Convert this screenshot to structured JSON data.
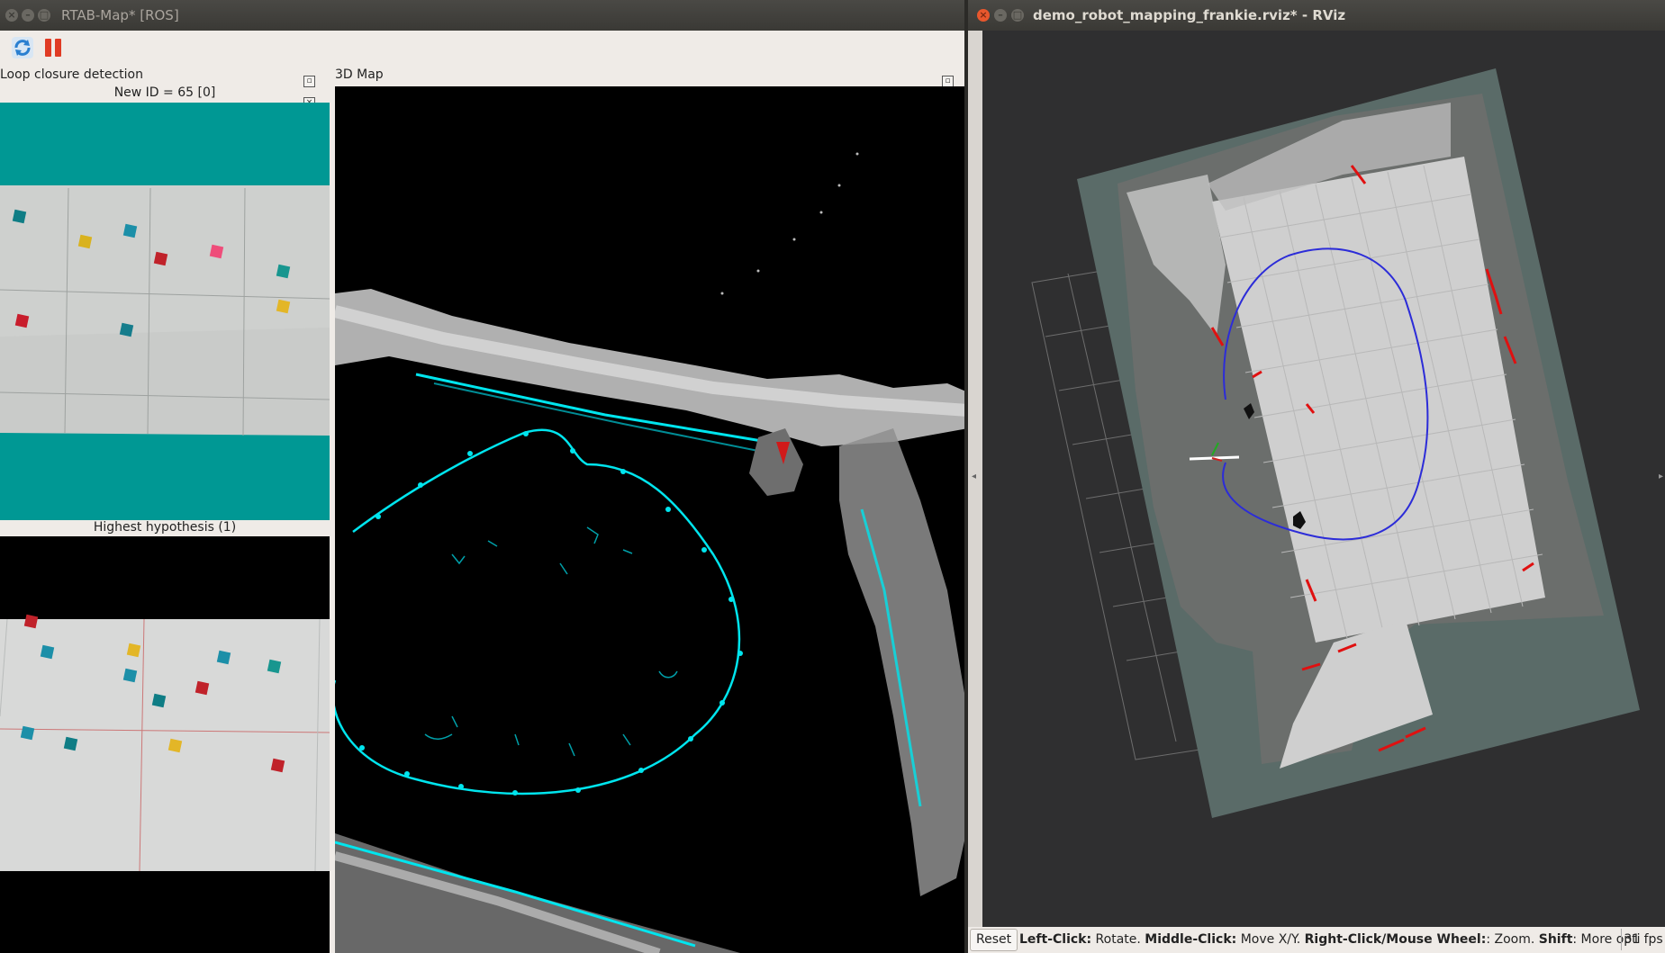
{
  "left_window": {
    "title": "RTAB-Map* [ROS]",
    "toolbar": {
      "refresh_icon": "refresh-icon",
      "pause_icon": "pause-icon"
    },
    "loop_panel": {
      "title": "Loop closure detection",
      "new_id_caption": "New ID = 65 [0]",
      "hypothesis_caption": "Highest hypothesis (1)"
    },
    "map_panel": {
      "title": "3D Map"
    },
    "colors": {
      "teal_band": "#009894",
      "trajectory": "#00e5ee",
      "panel_bg": "#efebe7"
    }
  },
  "right_window": {
    "title": "demo_robot_mapping_frankie.rviz* - RViz",
    "status": {
      "reset_label": "Reset",
      "hint_parts": [
        {
          "bold": "Left-Click:",
          "text": " Rotate. "
        },
        {
          "bold": "Middle-Click:",
          "text": " Move X/Y. "
        },
        {
          "bold": "Right-Click/Mouse Wheel:",
          "text": ": Zoom. "
        },
        {
          "bold": "Shift",
          "text": ": More opti"
        }
      ],
      "fps": "31 fps"
    },
    "colors": {
      "map_bg": "#5a6b68",
      "floor": "#cfcfcf",
      "path": "#2c2cd8",
      "obstacles": "#e01010"
    }
  }
}
